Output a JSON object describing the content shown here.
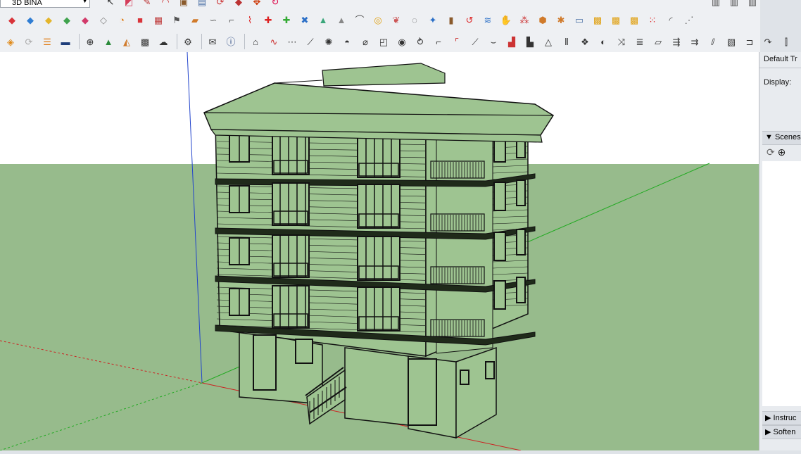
{
  "model_dropdown": {
    "value": "3D BİNA"
  },
  "toolbar_top": {
    "tools": [
      {
        "name": "select-icon",
        "glyph": "↖",
        "color": "#222"
      },
      {
        "name": "eraser-icon",
        "glyph": "◩",
        "color": "#d43d5a"
      },
      {
        "name": "pencil-icon",
        "glyph": "✎",
        "color": "#b33"
      },
      {
        "name": "arc-icon",
        "glyph": "◠",
        "color": "#c33"
      },
      {
        "name": "push-pull-icon",
        "glyph": "▣",
        "color": "#8a5a2b"
      },
      {
        "name": "box-icon",
        "glyph": "▤",
        "color": "#4a6fa5"
      },
      {
        "name": "follow-me-icon",
        "glyph": "⟳",
        "color": "#c33"
      },
      {
        "name": "paint-icon",
        "glyph": "◆",
        "color": "#b33"
      },
      {
        "name": "move-icon",
        "glyph": "✥",
        "color": "#c30"
      },
      {
        "name": "rotate-icon",
        "glyph": "↻",
        "color": "#d04"
      }
    ]
  },
  "toolbar_row1": {
    "tools": [
      {
        "name": "layer-red-icon",
        "glyph": "◆",
        "color": "#d9343a"
      },
      {
        "name": "layer-blue-icon",
        "glyph": "◆",
        "color": "#2f7dd3"
      },
      {
        "name": "layer-yellow-icon",
        "glyph": "◆",
        "color": "#e4b52b"
      },
      {
        "name": "layer-green-icon",
        "glyph": "◆",
        "color": "#3fa34d"
      },
      {
        "name": "layer-pink-icon",
        "glyph": "◆",
        "color": "#d23a6a"
      },
      {
        "name": "layer-gray-icon",
        "glyph": "◇",
        "color": "#888"
      },
      {
        "name": "spiral-icon",
        "glyph": "◔",
        "color": "#e07a10"
      },
      {
        "name": "red-square-icon",
        "glyph": "■",
        "color": "#d9343a"
      },
      {
        "name": "grid-icon",
        "glyph": "▦",
        "color": "#c04040"
      },
      {
        "name": "flag-icon",
        "glyph": "⚑",
        "color": "#555"
      },
      {
        "name": "cube-orange-icon",
        "glyph": "▰",
        "color": "#d07a2a"
      },
      {
        "name": "pipe-icon",
        "glyph": "∽",
        "color": "#666"
      },
      {
        "name": "corner-icon",
        "glyph": "⌐",
        "color": "#555"
      },
      {
        "name": "bezier-icon",
        "glyph": "⌇",
        "color": "#d22"
      },
      {
        "name": "plus-red-icon",
        "glyph": "✚",
        "color": "#d22"
      },
      {
        "name": "plus-green-icon",
        "glyph": "✚",
        "color": "#3a3"
      },
      {
        "name": "cross-blue-icon",
        "glyph": "✖",
        "color": "#2b6fc7"
      },
      {
        "name": "triangle-icon",
        "glyph": "▲",
        "color": "#3aa67a"
      },
      {
        "name": "triangle-alt-icon",
        "glyph": "▲",
        "color": "#888"
      },
      {
        "name": "lasso-icon",
        "glyph": "⌒",
        "color": "#555"
      },
      {
        "name": "rope-icon",
        "glyph": "◎",
        "color": "#e0a010"
      },
      {
        "name": "curl-icon",
        "glyph": "❦",
        "color": "#c55"
      },
      {
        "name": "ring-icon",
        "glyph": "◌",
        "color": "#555"
      },
      {
        "name": "star-blue-icon",
        "glyph": "✦",
        "color": "#2b6fc7"
      },
      {
        "name": "bucket-icon",
        "glyph": "▮",
        "color": "#8a5a2b"
      },
      {
        "name": "loop-red-icon",
        "glyph": "↺",
        "color": "#d22"
      },
      {
        "name": "wave-icon",
        "glyph": "≋",
        "color": "#2b6fc7"
      },
      {
        "name": "hand-icon",
        "glyph": "✋",
        "color": "#2b6fc7"
      },
      {
        "name": "nodes-icon",
        "glyph": "⁂",
        "color": "#c33"
      },
      {
        "name": "hex-icon",
        "glyph": "⬢",
        "color": "#d07a2a"
      },
      {
        "name": "bug-icon",
        "glyph": "✱",
        "color": "#d07a2a"
      },
      {
        "name": "tile-icon",
        "glyph": "▭",
        "color": "#4a6fa5"
      },
      {
        "name": "pattern-a-icon",
        "glyph": "▩",
        "color": "#e0a010"
      },
      {
        "name": "pattern-b-icon",
        "glyph": "▩",
        "color": "#e0a010"
      },
      {
        "name": "pattern-c-icon",
        "glyph": "▩",
        "color": "#e0a010"
      },
      {
        "name": "points-icon",
        "glyph": "⁙",
        "color": "#d22"
      },
      {
        "name": "dotted-arc-icon",
        "glyph": "◜",
        "color": "#555"
      },
      {
        "name": "dotted-path-icon",
        "glyph": "⋰",
        "color": "#555"
      }
    ]
  },
  "toolbar_right_top": {
    "tools": [
      {
        "name": "component-a-icon",
        "glyph": "▥",
        "color": "#444"
      },
      {
        "name": "component-b-icon",
        "glyph": "▥",
        "color": "#444"
      },
      {
        "name": "component-c-icon",
        "glyph": "▥",
        "color": "#444"
      },
      {
        "name": "component-d-icon",
        "glyph": "▥",
        "color": "#444"
      }
    ]
  },
  "toolbar_row2": {
    "tools": [
      {
        "name": "orange-box-icon",
        "glyph": "◈",
        "color": "#e08a1a"
      },
      {
        "name": "refresh-icon",
        "glyph": "⟳",
        "color": "#aaa"
      },
      {
        "name": "layers-stack-icon",
        "glyph": "☰",
        "color": "#e07a10"
      },
      {
        "name": "monitor-icon",
        "glyph": "▬",
        "color": "#1d3d7a"
      },
      {
        "name": "sep",
        "glyph": "",
        "color": ""
      },
      {
        "name": "add-circle-icon",
        "glyph": "⊕",
        "color": "#222"
      },
      {
        "name": "tree-icon",
        "glyph": "▲",
        "color": "#2a8a3a"
      },
      {
        "name": "landscape-icon",
        "glyph": "◭",
        "color": "#d07a2a"
      },
      {
        "name": "checker-icon",
        "glyph": "▩",
        "color": "#333"
      },
      {
        "name": "cloud-upload-icon",
        "glyph": "☁",
        "color": "#333"
      },
      {
        "name": "sep",
        "glyph": "",
        "color": ""
      },
      {
        "name": "gear-icon",
        "glyph": "⚙",
        "color": "#333"
      },
      {
        "name": "sep",
        "glyph": "",
        "color": ""
      },
      {
        "name": "mail-icon",
        "glyph": "✉",
        "color": "#333"
      },
      {
        "name": "info-icon",
        "glyph": "ⓘ",
        "color": "#1d3d7a"
      },
      {
        "name": "sep",
        "glyph": "",
        "color": ""
      },
      {
        "name": "extrude-edges-icon",
        "glyph": "⌂",
        "color": "#333"
      },
      {
        "name": "path-icon",
        "glyph": "∿",
        "color": "#c33"
      },
      {
        "name": "connect-icon",
        "glyph": "⋯",
        "color": "#333"
      },
      {
        "name": "knife-icon",
        "glyph": "⟋",
        "color": "#333"
      },
      {
        "name": "wheel-icon",
        "glyph": "✺",
        "color": "#333"
      },
      {
        "name": "blob-icon",
        "glyph": "◓",
        "color": "#333"
      },
      {
        "name": "cylinder-icon",
        "glyph": "⌀",
        "color": "#333"
      },
      {
        "name": "cube-outline-icon",
        "glyph": "◰",
        "color": "#333"
      },
      {
        "name": "sphere-icon",
        "glyph": "◉",
        "color": "#333"
      },
      {
        "name": "helix-icon",
        "glyph": "⥁",
        "color": "#333"
      },
      {
        "name": "fillet-icon",
        "glyph": "⌐",
        "color": "#333"
      },
      {
        "name": "chamfer-icon",
        "glyph": "⌜",
        "color": "#c33"
      },
      {
        "name": "slope-icon",
        "glyph": "⟋",
        "color": "#333"
      },
      {
        "name": "curve-icon",
        "glyph": "⌣",
        "color": "#333"
      },
      {
        "name": "stairs-a-icon",
        "glyph": "▟",
        "color": "#c33"
      },
      {
        "name": "stairs-b-icon",
        "glyph": "▙",
        "color": "#333"
      },
      {
        "name": "pyramid-icon",
        "glyph": "△",
        "color": "#333"
      },
      {
        "name": "columns-icon",
        "glyph": "⫴",
        "color": "#333"
      },
      {
        "name": "mesh-icon",
        "glyph": "❖",
        "color": "#333"
      },
      {
        "name": "shell-icon",
        "glyph": "◐",
        "color": "#333"
      },
      {
        "name": "twist-icon",
        "glyph": "⤨",
        "color": "#333"
      },
      {
        "name": "layers-icon",
        "glyph": "≣",
        "color": "#333"
      },
      {
        "name": "plane-icon",
        "glyph": "▱",
        "color": "#333"
      },
      {
        "name": "arrows-a-icon",
        "glyph": "⇶",
        "color": "#333"
      },
      {
        "name": "arrows-b-icon",
        "glyph": "⇉",
        "color": "#333"
      },
      {
        "name": "stripes-icon",
        "glyph": "⫽",
        "color": "#333"
      },
      {
        "name": "hatch-icon",
        "glyph": "▧",
        "color": "#333"
      },
      {
        "name": "bracket-icon",
        "glyph": "⊐",
        "color": "#333"
      },
      {
        "name": "rotate-face-icon",
        "glyph": "↷",
        "color": "#333"
      },
      {
        "name": "split-icon",
        "glyph": "⫿",
        "color": "#333"
      }
    ]
  },
  "panel": {
    "tray_title": "Default Tr",
    "display_label": "Display:",
    "scenes_label": "Scenes",
    "instructor_label": "Instruc",
    "soften_label": "Soften"
  },
  "colors": {
    "sky": "#ffffff",
    "ground": "#97bb8c",
    "building_fill": "#9ec491",
    "edge": "#111111",
    "axis_red": "#cc2222",
    "axis_green": "#22aa22",
    "axis_blue": "#2244cc"
  }
}
